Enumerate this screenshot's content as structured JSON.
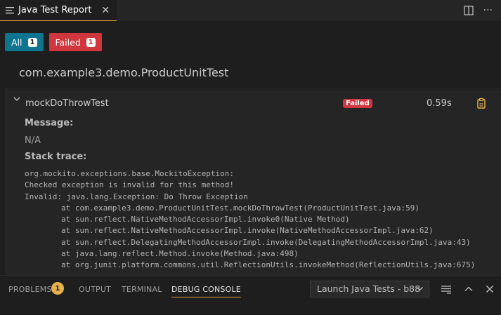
{
  "editor_tab": {
    "title": "Java Test Report"
  },
  "filters": {
    "all": {
      "label": "All",
      "count": "1"
    },
    "failed": {
      "label": "Failed",
      "count": "1"
    }
  },
  "report": {
    "class_name": "com.example3.demo.ProductUnitTest",
    "test": {
      "name": "mockDoThrowTest",
      "status": "Failed",
      "duration": "0.59s",
      "message_label": "Message:",
      "message": "N/A",
      "stack_trace_label": "Stack trace:",
      "stack_trace": [
        "org.mockito.exceptions.base.MockitoException:",
        "Checked exception is invalid for this method!",
        "Invalid: java.lang.Exception: Do Throw Exception",
        "at com.example3.demo.ProductUnitTest.mockDoThrowTest(ProductUnitTest.java:59)",
        "at sun.reflect.NativeMethodAccessorImpl.invoke0(Native Method)",
        "at sun.reflect.NativeMethodAccessorImpl.invoke(NativeMethodAccessorImpl.java:62)",
        "at sun.reflect.DelegatingMethodAccessorImpl.invoke(DelegatingMethodAccessorImpl.java:43)",
        "at java.lang.reflect.Method.invoke(Method.java:498)",
        "at org.junit.platform.commons.util.ReflectionUtils.invokeMethod(ReflectionUtils.java:675)"
      ]
    }
  },
  "panel": {
    "tabs": [
      "PROBLEMS",
      "OUTPUT",
      "TERMINAL",
      "DEBUG CONSOLE"
    ],
    "problems_count": "1",
    "launch_config": "Launch Java Tests - b88"
  },
  "colors": {
    "accent": "#e2a03b",
    "all_button": "#0e7490",
    "failed": "#d0363e",
    "copy_icon": "#e8b24a"
  }
}
